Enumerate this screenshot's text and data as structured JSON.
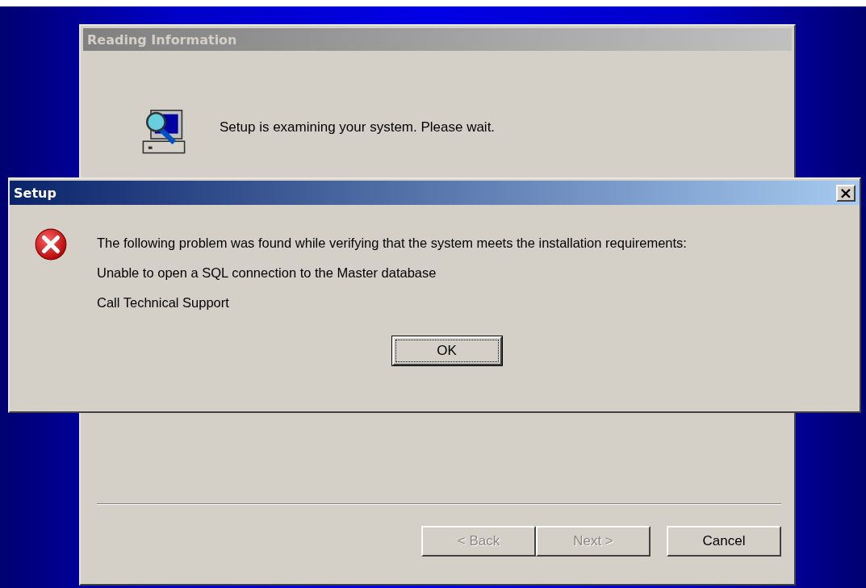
{
  "wizard": {
    "title": "Reading Information",
    "active": false,
    "message": "Setup is examining your system. Please wait.",
    "buttons": [
      {
        "label": "< Back",
        "disabled": true
      },
      {
        "label": "Next >",
        "disabled": true
      },
      {
        "label": "Cancel",
        "disabled": false
      }
    ]
  },
  "dialog": {
    "title": "Setup",
    "active": true,
    "close": "×",
    "messages": [
      "The following problem was found while verifying that the system meets the installation requirements:",
      "Unable to open a SQL connection to the Master database",
      "Call Technical Support"
    ],
    "buttons": [
      {
        "label": "OK",
        "focused": true
      }
    ]
  }
}
